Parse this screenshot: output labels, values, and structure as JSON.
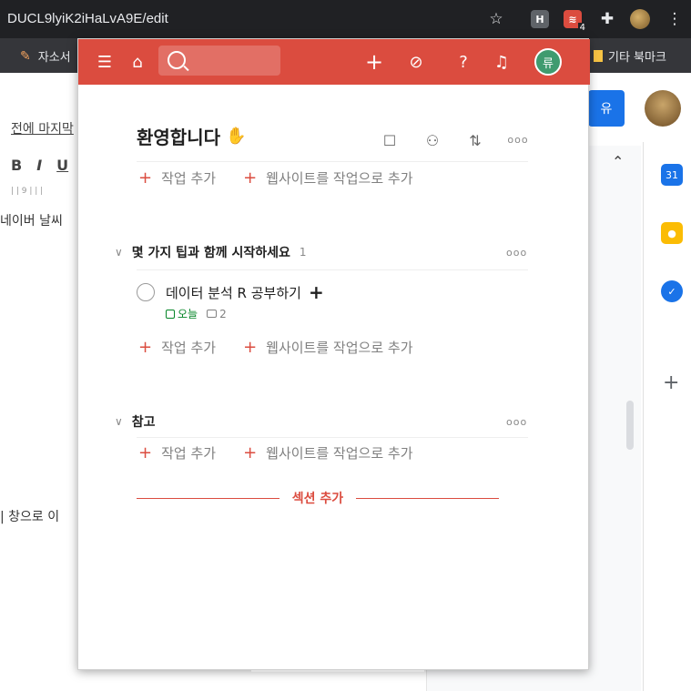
{
  "browser": {
    "url": "DUCL9lyiK2iHaLvA9E/edit",
    "star_icon": "star-icon",
    "extension_badge": "4",
    "bookmark_left": "자소서",
    "bookmark_right": "기타 북마크"
  },
  "doc": {
    "last_edit": "전에 마지막",
    "toolbar": [
      "B",
      "I",
      "U"
    ],
    "ruler": "9",
    "line1": "네이버 날씨",
    "line2": "창으로 이",
    "share_label": "유"
  },
  "todoist": {
    "header": {
      "search_placeholder": "",
      "accent": "#db4c3f",
      "avatar_initial": "류"
    },
    "project_title": "환영합니다",
    "add_task": "작업 추가",
    "add_website": "웹사이트를 작업으로 추가",
    "sections": [
      {
        "title": "몇 가지 팁과 함께 시작하세요",
        "count": "1",
        "tasks": [
          {
            "title": "데이터 분석 R 공부하기",
            "due": "오늘",
            "comments": "2"
          }
        ]
      },
      {
        "title": "참고",
        "count": "",
        "tasks": []
      }
    ],
    "add_section": "섹션 추가"
  }
}
